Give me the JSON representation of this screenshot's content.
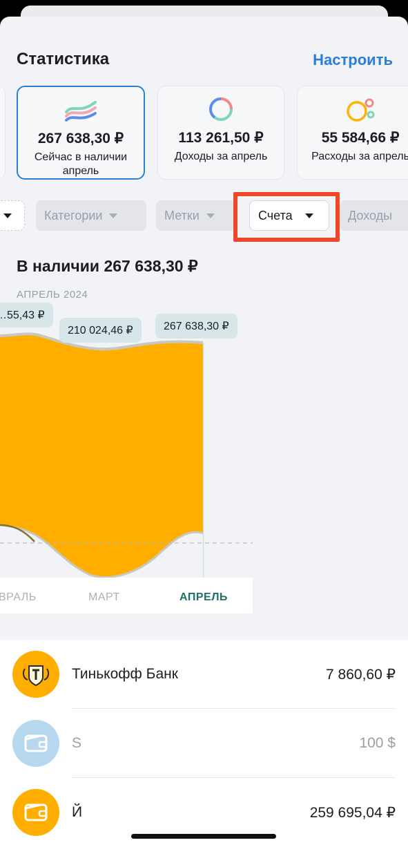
{
  "header": {
    "title": "Статистика",
    "action": "Настроить"
  },
  "cards": [
    {
      "value": "267 638,30 ₽",
      "label": "Сейчас в наличии апрель",
      "icon": "waves-icon",
      "selected": true
    },
    {
      "value": "113 261,50 ₽",
      "label": "Доходы за апрель",
      "icon": "ring-icon",
      "selected": false
    },
    {
      "value": "55 584,66 ₽",
      "label": "Расходы за апрель",
      "icon": "bubbles-icon",
      "selected": false
    }
  ],
  "filters": [
    {
      "label": "Категории",
      "active": false
    },
    {
      "label": "Метки",
      "active": false
    },
    {
      "label": "Счета",
      "active": true
    },
    {
      "label": "Доходы",
      "active": false
    }
  ],
  "section": {
    "title": "В наличии 267 638,30 ₽",
    "month": "АПРЕЛЬ 2024"
  },
  "chart_data": {
    "type": "area",
    "x": [
      "ФЕВРАЛЬ",
      "МАРТ",
      "АПРЕЛЬ"
    ],
    "current": "АПРЕЛЬ",
    "tooltips": [
      "…55,43 ₽",
      "210 024,46 ₽",
      "267 638,30 ₽"
    ],
    "series": [
      {
        "values": [
          null,
          210024.46,
          267638.3
        ],
        "color": "#ffae00"
      }
    ],
    "axis_labels": [
      "ВРАЛЬ",
      "МАРТ",
      "АПРЕЛЬ"
    ]
  },
  "accounts": [
    {
      "name": "Тинькофф Банк",
      "value": "7 860,60 ₽",
      "icon": "tinkoff-logo-icon",
      "color": "#ffae00",
      "muted": false
    },
    {
      "name": "S",
      "value": "100 $",
      "icon": "wallet-icon",
      "color": "#b7d8ee",
      "muted": true
    },
    {
      "name": "Й",
      "value": "259 695,04 ₽",
      "icon": "wallet-icon",
      "color": "#ffae00",
      "muted": false
    }
  ]
}
